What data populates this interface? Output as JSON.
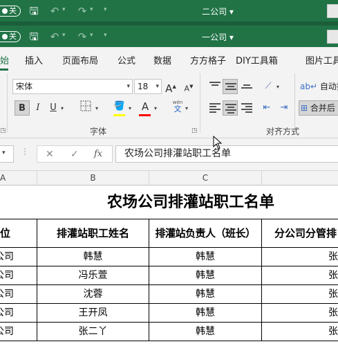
{
  "titlebars": [
    {
      "autosave_label": "关",
      "doc_title": "二公司 ▾"
    },
    {
      "autosave_label": "关",
      "doc_title": "一公司 ▾"
    }
  ],
  "tabs": [
    {
      "label": "始",
      "active": true
    },
    {
      "label": "插入"
    },
    {
      "label": "页面布局"
    },
    {
      "label": "公式"
    },
    {
      "label": "数据"
    },
    {
      "label": "方方格子"
    },
    {
      "label": "DIY工具箱"
    },
    {
      "label": "图片工具"
    }
  ],
  "ribbon": {
    "font_name": "宋体",
    "font_size": "18",
    "grow_font": "A",
    "shrink_font": "A",
    "bold": "B",
    "italic": "I",
    "underline": "U",
    "font_color_letter": "A",
    "phonetic_top": "wén",
    "phonetic_bottom": "文",
    "font_group_label": "字体",
    "wrap_text_label": "自动换",
    "merge_label": "合并后",
    "align_group_label": "对齐方式",
    "highlight_color": "#ffff00",
    "font_color": "#ff0000"
  },
  "formula_bar": {
    "cancel": "✕",
    "confirm": "✓",
    "fx": "fx",
    "formula": "农场公司排灌站职工名单"
  },
  "sheet": {
    "columns": [
      "A",
      "B",
      "C"
    ],
    "title": "农场公司排灌站职工名单",
    "headers": [
      "位",
      "排灌站职工姓名",
      "排灌站负责人（班长）",
      "分公司分管排"
    ],
    "rows": [
      [
        "公司",
        "韩慧",
        "韩慧",
        "张"
      ],
      [
        "公司",
        "冯乐萱",
        "韩慧",
        "张"
      ],
      [
        "公司",
        "沈蓉",
        "韩慧",
        "张"
      ],
      [
        "公司",
        "王开凤",
        "韩慧",
        "张"
      ],
      [
        "公司",
        "张二丫",
        "韩慧",
        "张"
      ]
    ]
  }
}
